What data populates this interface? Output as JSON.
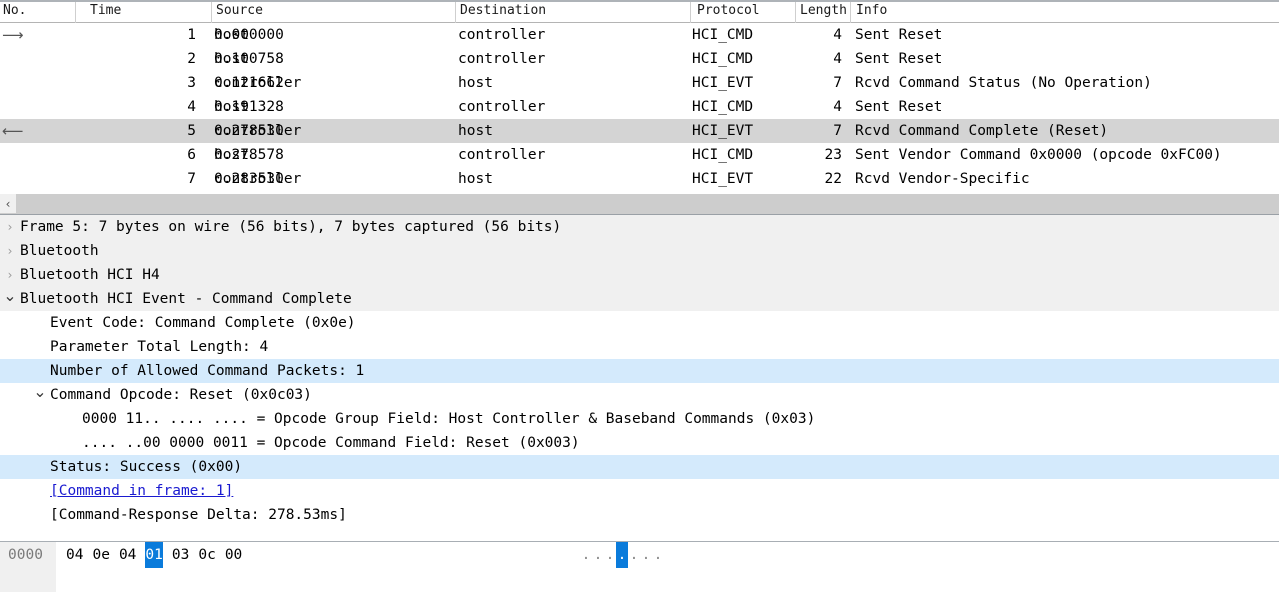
{
  "packet_list": {
    "columns": [
      {
        "key": "no",
        "label": "No."
      },
      {
        "key": "time",
        "label": "Time"
      },
      {
        "key": "src",
        "label": "Source"
      },
      {
        "key": "dst",
        "label": "Destination"
      },
      {
        "key": "proto",
        "label": "Protocol"
      },
      {
        "key": "len",
        "label": "Length"
      },
      {
        "key": "info",
        "label": "Info"
      }
    ],
    "rows": [
      {
        "dir": "→",
        "no": "1",
        "time": "0.000000",
        "src": "host",
        "dst": "controller",
        "proto": "HCI_CMD",
        "len": "4",
        "info": "Sent Reset",
        "selected": false
      },
      {
        "dir": "",
        "no": "2",
        "time": "0.100758",
        "src": "host",
        "dst": "controller",
        "proto": "HCI_CMD",
        "len": "4",
        "info": "Sent Reset",
        "selected": false
      },
      {
        "dir": "",
        "no": "3",
        "time": "0.121662",
        "src": "controller",
        "dst": "host",
        "proto": "HCI_EVT",
        "len": "7",
        "info": "Rcvd Command Status (No Operation)",
        "selected": false
      },
      {
        "dir": "",
        "no": "4",
        "time": "0.191328",
        "src": "host",
        "dst": "controller",
        "proto": "HCI_CMD",
        "len": "4",
        "info": "Sent Reset",
        "selected": false
      },
      {
        "dir": "←",
        "no": "5",
        "time": "0.278530",
        "src": "controller",
        "dst": "host",
        "proto": "HCI_EVT",
        "len": "7",
        "info": "Rcvd Command Complete (Reset)",
        "selected": true
      },
      {
        "dir": "",
        "no": "6",
        "time": "0.278578",
        "src": "host",
        "dst": "controller",
        "proto": "HCI_CMD",
        "len": "23",
        "info": "Sent Vendor Command 0x0000 (opcode 0xFC00)",
        "selected": false
      },
      {
        "dir": "",
        "no": "7",
        "time": "0.283530",
        "src": "controller",
        "dst": "host",
        "proto": "HCI_EVT",
        "len": "22",
        "info": "Rcvd Vendor-Specific",
        "selected": false
      }
    ],
    "scrollbar": {
      "left_arrow": "‹"
    }
  },
  "detail_pane": {
    "rows": [
      {
        "chevron": "closed",
        "indent": 0,
        "text": "Frame 5: 7 bytes on wire (56 bits), 7 bytes captured (56 bits)",
        "bg": "gray",
        "link": false
      },
      {
        "chevron": "closed",
        "indent": 0,
        "text": "Bluetooth",
        "bg": "gray",
        "link": false
      },
      {
        "chevron": "closed",
        "indent": 0,
        "text": "Bluetooth HCI H4",
        "bg": "gray",
        "link": false
      },
      {
        "chevron": "open",
        "indent": 0,
        "text": "Bluetooth HCI Event - Command Complete",
        "bg": "gray",
        "link": false
      },
      {
        "chevron": "none",
        "indent": 1,
        "text": "Event Code: Command Complete (0x0e)",
        "bg": "none",
        "link": false
      },
      {
        "chevron": "none",
        "indent": 1,
        "text": "Parameter Total Length: 4",
        "bg": "none",
        "link": false
      },
      {
        "chevron": "none",
        "indent": 1,
        "text": "Number of Allowed Command Packets: 1",
        "bg": "blue",
        "link": false
      },
      {
        "chevron": "open",
        "indent": 1,
        "text": "Command Opcode: Reset (0x0c03)",
        "bg": "none",
        "link": false
      },
      {
        "chevron": "none",
        "indent": 2,
        "text": "0000 11.. .... .... = Opcode Group Field: Host Controller & Baseband Commands (0x03)",
        "bg": "none",
        "link": false
      },
      {
        "chevron": "none",
        "indent": 2,
        "text": ".... ..00 0000 0011 = Opcode Command Field: Reset (0x003)",
        "bg": "none",
        "link": false
      },
      {
        "chevron": "none",
        "indent": 1,
        "text": "Status: Success (0x00)",
        "bg": "blue",
        "link": false
      },
      {
        "chevron": "none",
        "indent": 1,
        "text": "[Command in frame: 1]",
        "bg": "none",
        "link": true
      },
      {
        "chevron": "none",
        "indent": 1,
        "text": "[Command-Response Delta: 278.53ms]",
        "bg": "none",
        "link": false
      }
    ]
  },
  "hex_pane": {
    "offset": "0000",
    "bytes": [
      "04",
      "0e",
      "04",
      "01",
      "03",
      "0c",
      "00"
    ],
    "highlighted_index": 3,
    "ascii": [
      ".",
      ".",
      ".",
      ".",
      ".",
      ".",
      "."
    ]
  },
  "colors": {
    "selected_row": "#d4d4d4",
    "highlight_blue": "#d4eafc",
    "byte_highlight": "#0a7bdb",
    "tree_gray": "#f0f0f0",
    "link": "#1a1ad0"
  }
}
